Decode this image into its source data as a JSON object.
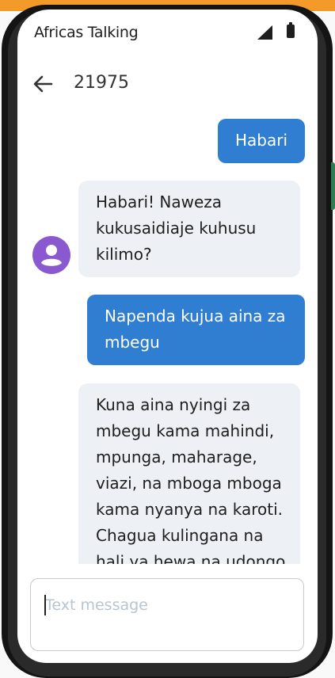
{
  "status_bar": {
    "carrier": "Africas Talking",
    "signal_icon": "signal-icon",
    "battery_icon": "battery-icon"
  },
  "header": {
    "back_icon": "arrow-left-icon",
    "contact": "21975"
  },
  "messages": [
    {
      "direction": "outgoing",
      "text": "Habari"
    },
    {
      "direction": "incoming",
      "text": "Habari! Naweza kukusaidiaje kuhusu kilimo?"
    },
    {
      "direction": "outgoing",
      "text": "Napenda kujua aina za mbegu"
    },
    {
      "direction": "incoming",
      "text": "Kuna aina nyingi za mbegu kama mahindi, mpunga, maharage, viazi, na mboga mboga kama nyanya na karoti. Chagua kulingana na hali ya hewa na udongo"
    }
  ],
  "composer": {
    "placeholder": "Text message",
    "value": ""
  },
  "colors": {
    "accent": "#f39a29",
    "outgoing_bubble": "#2f7ed1",
    "incoming_bubble": "#edf0f4",
    "avatar": "#8a58cf"
  }
}
